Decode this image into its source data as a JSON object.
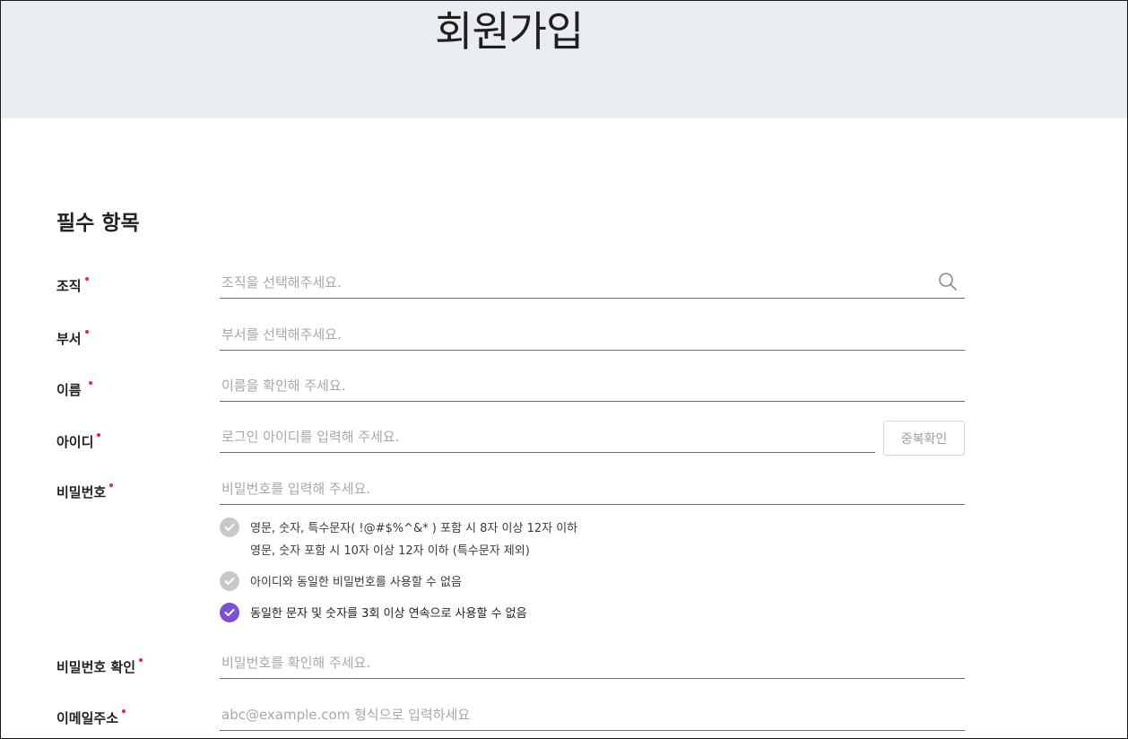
{
  "header": {
    "title": "회원가입"
  },
  "section": {
    "title": "필수 항목"
  },
  "fields": {
    "organization": {
      "label": "조직",
      "placeholder": "조직을 선택해주세요."
    },
    "department": {
      "label": "부서",
      "placeholder": "부서를 선택해주세요."
    },
    "name": {
      "label": "이름",
      "placeholder": "이름을 확인해 주세요."
    },
    "user_id": {
      "label": "아이디",
      "placeholder": "로그인 아이디를 입력해 주세요.",
      "button": "중복확인"
    },
    "password": {
      "label": "비밀번호",
      "placeholder": "비밀번호를 입력해 주세요."
    },
    "password_confirm": {
      "label": "비밀번호 확인",
      "placeholder": "비밀번호를 확인해 주세요."
    },
    "email": {
      "label": "이메일주소",
      "placeholder": "abc@example.com 형식으로 입력하세요"
    }
  },
  "password_rules": [
    {
      "line1": "영문, 숫자, 특수문자( !@#$%^&* ) 포함 시 8자 이상 12자 이하",
      "line2": "영문, 숫자 포함 시 10자 이상 12자 이하 (특수문자 제외)",
      "checked": false
    },
    {
      "line1": "아이디와 동일한 비밀번호를 사용할 수 없음",
      "checked": false
    },
    {
      "line1": "동일한 문자 및 숫자를 3회 이상 연속으로 사용할 수 없음",
      "checked": true
    }
  ],
  "icons": {
    "search": "search-icon",
    "check": "check-icon"
  },
  "colors": {
    "header_bg": "#e9ecf1",
    "required_dot": "#e5283c",
    "check_active": "#7b4fd6",
    "check_inactive": "#c8c8c8"
  }
}
